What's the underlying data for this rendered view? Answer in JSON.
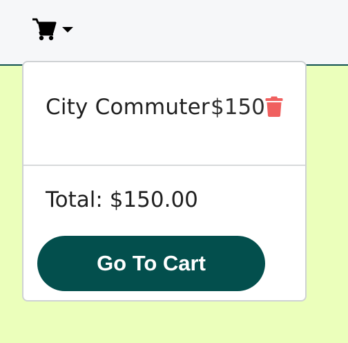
{
  "navbar": {
    "cart_icon": "shopping-cart-icon",
    "caret_icon": "caret-down-icon"
  },
  "cart_dropdown": {
    "items": [
      {
        "name": "City Commuter",
        "price": "$150",
        "remove_icon": "trash-icon"
      }
    ],
    "total": "Total: $150.00",
    "go_to_cart_label": "Go To Cart"
  },
  "colors": {
    "page_background": "#ebffbb",
    "navbar_background": "#f6f7f9",
    "accent": "#034f4d",
    "trash": "#f0605f"
  }
}
